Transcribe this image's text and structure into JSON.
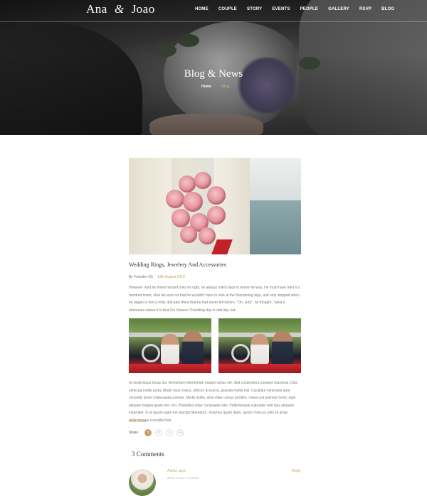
{
  "header": {
    "logo_left": "Ana",
    "logo_amp": "&",
    "logo_right": "Joao",
    "nav": [
      "HOME",
      "COUPLE",
      "STORY",
      "EVENTS",
      "PEOPLE",
      "GALLERY",
      "RSVP",
      "BLOG"
    ]
  },
  "hero": {
    "title": "Blog & News",
    "breadcrumb_home": "Home",
    "breadcrumb_current": "Blog"
  },
  "post": {
    "title": "Wedding Rings, Jewelery And Accessories",
    "author": "By Founder Gh",
    "date": "13th August 2019",
    "paragraph1": "However hard he threw himself onto his right, he always rolled back to where he was. He must have tried it a hundred times, shut his eyes so that he wouldn't have to look at the floundering legs, and only stopped when he began to feel a mild, dull pain there that he had never felt before. \"Oh, God\", he thought, \"what a strenuous career it is that I've chosen! Travelling day in and day out.",
    "paragraph2": "Ut scelerisque lacus dui, fermentum elementum mauris varius vel. Sed consectetur posuere maximus. Duis vehicula mollis porta. Morbi risus metus, ultrices at erat id, gravida mollis nisi. Curabitur venenatis ante convallis lorem malesuada pulvinar. Morbi mollis, ante vitae cursus porttitor, metus est pulvinar tortor, eget aliquam magna quam nec orci. Phasellus vitae consequat odio. Pellentesque vulputate velit quis aliquam imperdiet. In at ipsum eget nisl suscipit bibendum. Vivamus quam diam, auctor rhoncus odio sit amet, pellentesque convallis felis.",
    "read_more": "Read More",
    "share_label": "Share",
    "share_icons": [
      "f",
      "in",
      "⊙",
      "G+"
    ]
  },
  "comments": {
    "title": "3 Comments",
    "first": {
      "author": "Admin says",
      "date": "APRIL 9 2017 10:45 PM",
      "reply": "Reply"
    }
  }
}
